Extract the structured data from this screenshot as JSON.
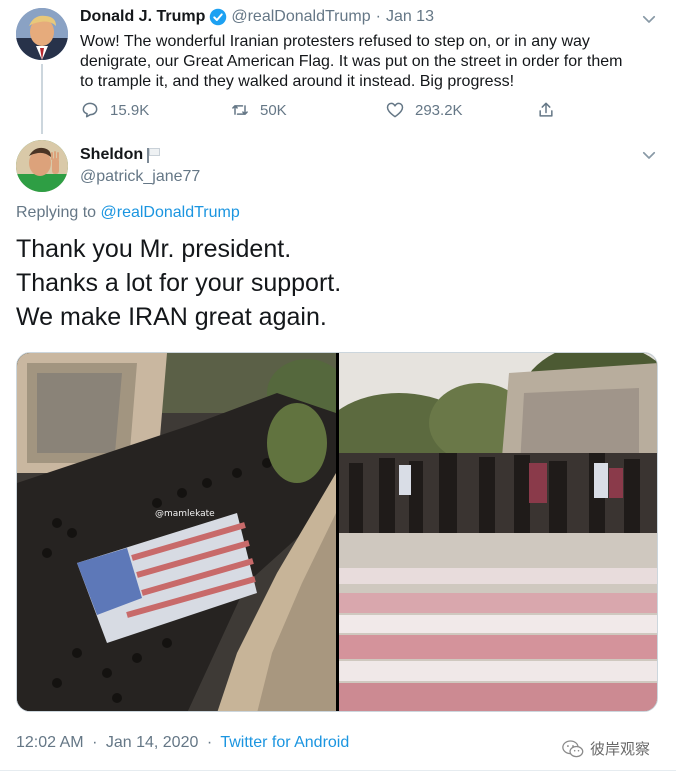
{
  "parent_tweet": {
    "author_name": "Donald J. Trump",
    "author_handle": "@realDonaldTrump",
    "separator": "·",
    "date": "Jan 13",
    "text": "Wow! The wonderful Iranian protesters refused to step on, or in any way denigrate, our Great American Flag. It was put on the street in order for them to trample it, and they walked around it instead. Big progress!",
    "reply_count": "15.9K",
    "retweet_count": "50K",
    "like_count": "293.2K",
    "icons": [
      "verified-badge-icon",
      "reply-icon",
      "retweet-icon",
      "like-icon",
      "share-icon",
      "chevron-down-icon"
    ]
  },
  "main_tweet": {
    "author_name": "Sheldon",
    "author_handle": "@patrick_jane77",
    "replying_prefix": "Replying to",
    "replying_handle": "@realDonaldTrump",
    "text_lines": [
      "Thank you Mr. president.",
      "Thanks a lot for your support.",
      "We make IRAN great again."
    ],
    "media_watermark": "@mamlekate",
    "time": "12:02 AM",
    "date": "Jan 14, 2020",
    "separator": "·",
    "source": "Twitter for Android",
    "icons": [
      "white-flag-icon",
      "chevron-down-icon"
    ]
  },
  "overlay_watermark": {
    "text": "彼岸观察",
    "icon": "wechat-icon"
  },
  "colors": {
    "link": "#1b95e0",
    "secondary_text": "#657786",
    "primary_text": "#14171a",
    "verified": "#1da1f2",
    "divider": "#ccd6dd"
  }
}
